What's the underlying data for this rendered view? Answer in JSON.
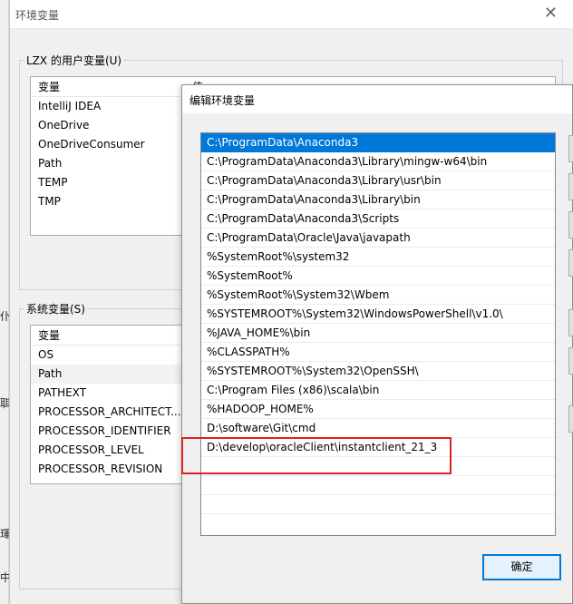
{
  "outer_dialog": {
    "title": "环境变量",
    "close_symbol": "✕",
    "user_vars": {
      "group_label": "LZX 的用户变量(U)",
      "column_name": "变量",
      "column_value_partial": "值",
      "items": [
        "IntelliJ IDEA",
        "OneDrive",
        "OneDriveConsumer",
        "Path",
        "TEMP",
        "TMP"
      ]
    },
    "system_vars": {
      "group_label": "系统变量(S)",
      "column_name": "变量",
      "items": [
        "OS",
        "Path",
        "PATHEXT",
        "PROCESSOR_ARCHITECT...",
        "PROCESSOR_IDENTIFIER",
        "PROCESSOR_LEVEL",
        "PROCESSOR_REVISION"
      ]
    }
  },
  "background_window": {
    "partial_chars": [
      "仆",
      "聑",
      "琿",
      "中"
    ]
  },
  "edit_dialog": {
    "title": "编辑环境变量",
    "paths": [
      "C:\\ProgramData\\Anaconda3",
      "C:\\ProgramData\\Anaconda3\\Library\\mingw-w64\\bin",
      "C:\\ProgramData\\Anaconda3\\Library\\usr\\bin",
      "C:\\ProgramData\\Anaconda3\\Library\\bin",
      "C:\\ProgramData\\Anaconda3\\Scripts",
      "C:\\ProgramData\\Oracle\\Java\\javapath",
      "%SystemRoot%\\system32",
      "%SystemRoot%",
      "%SystemRoot%\\System32\\Wbem",
      "%SYSTEMROOT%\\System32\\WindowsPowerShell\\v1.0\\",
      "%JAVA_HOME%\\bin",
      "%CLASSPATH%",
      "%SYSTEMROOT%\\System32\\OpenSSH\\",
      "C:\\Program Files (x86)\\scala\\bin",
      "%HADOOP_HOME%",
      "D:\\software\\Git\\cmd",
      "D:\\develop\\oracleClient\\instantclient_21_3"
    ],
    "selected_index": 0,
    "ok_label": "确定"
  },
  "colors": {
    "selection": "#0078d7",
    "highlight_box": "#e02020"
  }
}
